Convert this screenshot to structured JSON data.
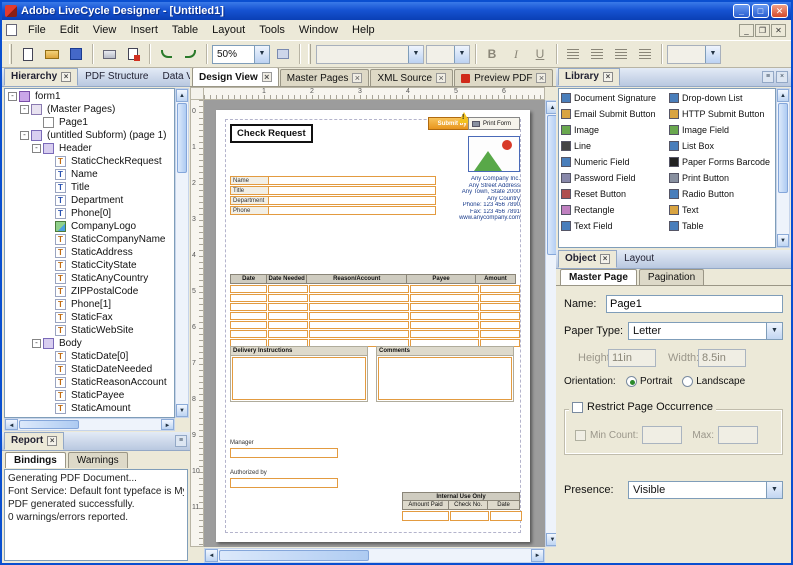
{
  "window": {
    "title": "Adobe LiveCycle Designer  - [Untitled1]",
    "menu": [
      "File",
      "Edit",
      "View",
      "Insert",
      "Table",
      "Layout",
      "Tools",
      "Window",
      "Help"
    ],
    "zoom": "50%",
    "bold": "B",
    "italic": "I",
    "underline": "U"
  },
  "hierarchy": {
    "tabs": [
      "Hierarchy",
      "PDF Structure",
      "Data View"
    ],
    "tree": [
      {
        "label": "form1",
        "level": 0,
        "icon": "form",
        "expand": true
      },
      {
        "label": "(Master Pages)",
        "level": 1,
        "icon": "pages",
        "expand": true
      },
      {
        "label": "Page1",
        "level": 2,
        "icon": "page"
      },
      {
        "label": "(untitled Subform) (page 1)",
        "level": 1,
        "icon": "subform",
        "expand": true
      },
      {
        "label": "Header",
        "level": 2,
        "icon": "subform",
        "expand": true
      },
      {
        "label": "StaticCheckRequest",
        "level": 3,
        "icon": "text"
      },
      {
        "label": "Name",
        "level": 3,
        "icon": "field"
      },
      {
        "label": "Title",
        "level": 3,
        "icon": "field"
      },
      {
        "label": "Department",
        "level": 3,
        "icon": "field"
      },
      {
        "label": "Phone[0]",
        "level": 3,
        "icon": "field"
      },
      {
        "label": "CompanyLogo",
        "level": 3,
        "icon": "image"
      },
      {
        "label": "StaticCompanyName",
        "level": 3,
        "icon": "text"
      },
      {
        "label": "StaticAddress",
        "level": 3,
        "icon": "text"
      },
      {
        "label": "StaticCityState",
        "level": 3,
        "icon": "text"
      },
      {
        "label": "StaticAnyCountry",
        "level": 3,
        "icon": "text"
      },
      {
        "label": "ZIPPostalCode",
        "level": 3,
        "icon": "text"
      },
      {
        "label": "Phone[1]",
        "level": 3,
        "icon": "text"
      },
      {
        "label": "StaticFax",
        "level": 3,
        "icon": "text"
      },
      {
        "label": "StaticWebSite",
        "level": 3,
        "icon": "text"
      },
      {
        "label": "Body",
        "level": 2,
        "icon": "subform",
        "expand": true
      },
      {
        "label": "StaticDate[0]",
        "level": 3,
        "icon": "text"
      },
      {
        "label": "StaticDateNeeded",
        "level": 3,
        "icon": "text"
      },
      {
        "label": "StaticReasonAccount",
        "level": 3,
        "icon": "text"
      },
      {
        "label": "StaticPayee",
        "level": 3,
        "icon": "text"
      },
      {
        "label": "StaticAmount",
        "level": 3,
        "icon": "text"
      }
    ]
  },
  "report": {
    "title": "Report",
    "tabs": [
      "Bindings",
      "Warnings"
    ],
    "lines": [
      "Generating PDF Document...",
      "Font Service: Default font typeface is Myr",
      "PDF generated successfully.",
      "0 warnings/errors reported."
    ]
  },
  "design": {
    "tabs": [
      {
        "label": "Design View"
      },
      {
        "label": "Master Pages"
      },
      {
        "label": "XML Source"
      },
      {
        "label": "Preview PDF",
        "icon": "pdf"
      }
    ],
    "ruler_h": [
      "1",
      "2",
      "3",
      "4",
      "5",
      "6"
    ],
    "ruler_v": [
      "0",
      "1",
      "2",
      "3",
      "4",
      "5",
      "6",
      "7",
      "8",
      "9",
      "10",
      "11"
    ],
    "form": {
      "title": "Check Request",
      "submit_button": "Submit by Email",
      "print_button": "Print Form",
      "field_labels": [
        "Name",
        "Title",
        "Department",
        "Phone"
      ],
      "company_lines": [
        "Any Company Inc.",
        "Any Street Address",
        "Any Town, State 2000",
        "Any Country",
        "Phone: 123 456 7890",
        "Fax: 123 456 7891",
        "www.anycompany.com"
      ],
      "table_headers": [
        "Date",
        "Date Needed",
        "Reason/Account",
        "Payee",
        "Amount"
      ],
      "table_rows": 7,
      "delivery_label": "Delivery Instructions",
      "comments_label": "Comments",
      "manager_label": "Manager",
      "authorized_label": "Authorized by",
      "internal_title": "Internal Use Only",
      "internal_headers": [
        "Amount Paid",
        "Check No.",
        "Date"
      ]
    }
  },
  "library": {
    "title": "Library",
    "items_left": [
      {
        "label": "Document Signature",
        "icon": "document-signature-icon",
        "color": "#4a7ebb"
      },
      {
        "label": "Email Submit Button",
        "icon": "email-submit-button-icon",
        "color": "#d9a441"
      },
      {
        "label": "Image",
        "icon": "image-icon",
        "color": "#6aa84f"
      },
      {
        "label": "Line",
        "icon": "line-icon",
        "color": "#444444"
      },
      {
        "label": "Numeric Field",
        "icon": "numeric-field-icon",
        "color": "#4a7ebb"
      },
      {
        "label": "Password Field",
        "icon": "password-field-icon",
        "color": "#8888aa"
      },
      {
        "label": "Reset Button",
        "icon": "reset-button-icon",
        "color": "#b05050"
      },
      {
        "label": "Rectangle",
        "icon": "rectangle-icon",
        "color": "#c080c0"
      },
      {
        "label": "Text Field",
        "icon": "text-field-icon",
        "color": "#4a7ebb"
      }
    ],
    "items_right": [
      {
        "label": "Drop-down List",
        "icon": "dropdown-list-icon",
        "color": "#4a7ebb"
      },
      {
        "label": "HTTP Submit Button",
        "icon": "http-submit-button-icon",
        "color": "#d9a441"
      },
      {
        "label": "Image Field",
        "icon": "image-field-icon",
        "color": "#6aa84f"
      },
      {
        "label": "List Box",
        "icon": "list-box-icon",
        "color": "#4a7ebb"
      },
      {
        "label": "Paper Forms Barcode",
        "icon": "paper-forms-barcode-icon",
        "color": "#222222"
      },
      {
        "label": "Print Button",
        "icon": "print-button-icon",
        "color": "#8890a0"
      },
      {
        "label": "Radio Button",
        "icon": "radio-button-icon",
        "color": "#4a7ebb"
      },
      {
        "label": "Text",
        "icon": "text-icon",
        "color": "#d9a441"
      },
      {
        "label": "Table",
        "icon": "table-icon",
        "color": "#4a7ebb"
      }
    ]
  },
  "object": {
    "tabs": [
      "Object",
      "Layout"
    ],
    "subtabs": [
      "Master Page",
      "Pagination"
    ],
    "name_label": "Name:",
    "name_value": "Page1",
    "paper_label": "Paper Type:",
    "paper_value": "Letter",
    "height_label": "Height:",
    "height_value": "11in",
    "width_label": "Width:",
    "width_value": "8.5in",
    "orientation_label": "Orientation:",
    "portrait_label": "Portrait",
    "landscape_label": "Landscape",
    "restrict_label": "Restrict Page Occurrence",
    "min_count_label": "Min Count:",
    "max_label": "Max:",
    "presence_label": "Presence:",
    "presence_value": "Visible"
  }
}
